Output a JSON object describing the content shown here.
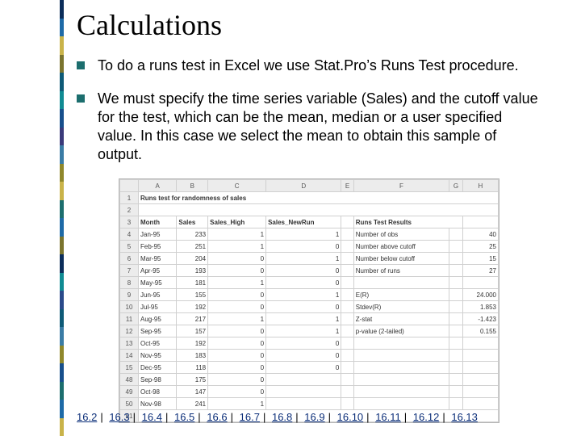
{
  "title": "Calculations",
  "bullets": [
    "To do a runs test in Excel we use Stat.Pro’s Runs Test procedure.",
    "We must specify the time series variable (Sales) and the cutoff value for the test, which can be the mean, median or a user specified value. In this case we select the mean to obtain this sample of output."
  ],
  "sheet": {
    "cols": [
      "A",
      "B",
      "C",
      "D",
      "E",
      "F",
      "G",
      "H"
    ],
    "title_row": "Runs test for randomness of sales",
    "headers": [
      "Month",
      "Sales",
      "Sales_High",
      "Sales_NewRun"
    ],
    "right_title": "Runs Test Results",
    "right": [
      [
        "Number of obs",
        "40"
      ],
      [
        "Number above cutoff",
        "25"
      ],
      [
        "Number below cutoff",
        "15"
      ],
      [
        "Number of runs",
        "27"
      ],
      [
        "",
        ""
      ],
      [
        "E(R)",
        "24.000"
      ],
      [
        "Stdev(R)",
        "1.853"
      ],
      [
        "Z-stat",
        "-1.423"
      ],
      [
        "p-value (2-tailed)",
        "0.155"
      ]
    ],
    "rows": [
      [
        "Jan-95",
        "233",
        "1",
        "1"
      ],
      [
        "Feb-95",
        "251",
        "1",
        "0"
      ],
      [
        "Mar-95",
        "204",
        "0",
        "1"
      ],
      [
        "Apr-95",
        "193",
        "0",
        "0"
      ],
      [
        "May-95",
        "181",
        "1",
        "0"
      ],
      [
        "Jun-95",
        "155",
        "0",
        "1"
      ],
      [
        "Jul-95",
        "192",
        "0",
        "0"
      ],
      [
        "Aug-95",
        "217",
        "1",
        "1"
      ],
      [
        "Sep-95",
        "157",
        "0",
        "1"
      ],
      [
        "Oct-95",
        "192",
        "0",
        "0"
      ],
      [
        "Nov-95",
        "183",
        "0",
        "0"
      ],
      [
        "Dec-95",
        "118",
        "0",
        "0"
      ],
      [
        "Sep-98",
        "175",
        "0",
        ""
      ],
      [
        "Oct-98",
        "147",
        "0",
        ""
      ],
      [
        "Nov-98",
        "241",
        "1",
        ""
      ]
    ],
    "last_rowhead": "51"
  },
  "footer_links": [
    "16.2",
    "16.3",
    "16.4",
    "16.5",
    "16.6",
    "16.7",
    "16.8",
    "16.9",
    "16.10",
    "16.11",
    "16.12",
    "16.13"
  ]
}
